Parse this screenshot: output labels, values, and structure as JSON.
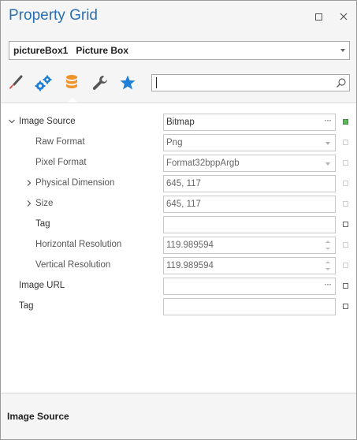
{
  "window": {
    "title": "Property Grid"
  },
  "object_selector": {
    "name": "pictureBox1",
    "type": "Picture Box"
  },
  "toolbar": {
    "buttons": [
      {
        "icon": "brush-icon",
        "selected": false
      },
      {
        "icon": "gears-icon",
        "selected": false
      },
      {
        "icon": "database-icon",
        "selected": true
      },
      {
        "icon": "wrench-icon",
        "selected": false
      },
      {
        "icon": "star-icon",
        "selected": false
      }
    ],
    "search": {
      "value": "",
      "placeholder": ""
    }
  },
  "properties": [
    {
      "label": "Image Source",
      "value": "Bitmap",
      "editor": "ellipsis",
      "expanded": true,
      "marker": "green"
    },
    {
      "label": "Raw Format",
      "value": "Png",
      "editor": "dropdown",
      "readonly": true,
      "marker": "light"
    },
    {
      "label": "Pixel Format",
      "value": "Format32bppArgb",
      "editor": "dropdown",
      "readonly": true,
      "marker": "light"
    },
    {
      "label": "Physical Dimension",
      "value": "645, 117",
      "editor": "text",
      "readonly": true,
      "collapsed": true,
      "marker": "light"
    },
    {
      "label": "Size",
      "value": "645, 117",
      "editor": "text",
      "readonly": true,
      "collapsed": true,
      "marker": "light"
    },
    {
      "label": "Tag",
      "value": "",
      "editor": "text",
      "marker": "normal"
    },
    {
      "label": "Horizontal Resolution",
      "value": "119.989594",
      "editor": "spin",
      "readonly": true,
      "marker": "light"
    },
    {
      "label": "Vertical Resolution",
      "value": "119.989594",
      "editor": "spin",
      "readonly": true,
      "marker": "light"
    },
    {
      "label": "Image URL",
      "value": "",
      "editor": "ellipsis",
      "marker": "normal"
    },
    {
      "label": "Tag",
      "value": "",
      "editor": "text",
      "marker": "normal"
    }
  ],
  "description": {
    "title": "Image Source"
  },
  "colors": {
    "title": "#2a6fb3",
    "selected_tab": "#f0932b",
    "accent_blue": "#1e7fd6",
    "marker_green": "#5cb85c"
  }
}
